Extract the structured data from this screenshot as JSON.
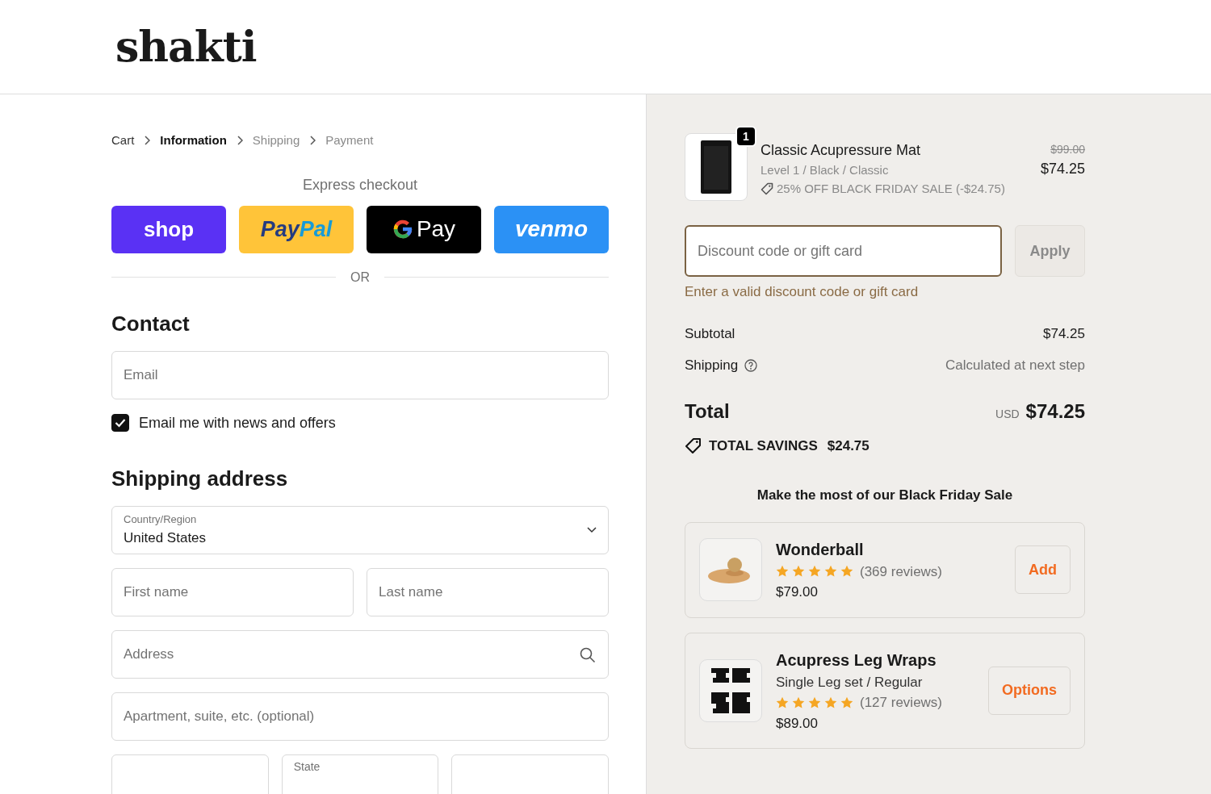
{
  "header": {
    "logo": "shakti"
  },
  "breadcrumb": [
    {
      "label": "Cart",
      "selected": false
    },
    {
      "label": "Information",
      "selected": true
    },
    {
      "label": "Shipping",
      "selected": false
    },
    {
      "label": "Payment",
      "selected": false
    }
  ],
  "express_checkout": {
    "title": "Express checkout",
    "wallets": [
      {
        "kind": "shop",
        "parts": [
          "shop"
        ]
      },
      {
        "kind": "paypal",
        "parts": [
          "Pay",
          "Pal"
        ]
      },
      {
        "kind": "gpay",
        "parts": [
          "Pay"
        ]
      },
      {
        "kind": "venmo",
        "parts": [
          "venmo"
        ]
      }
    ],
    "divider": "OR"
  },
  "contact": {
    "title": "Contact",
    "email": {
      "placeholder": "Email"
    },
    "newsletter": {
      "label": "Email me with news and offers",
      "checked": true
    }
  },
  "shipping_address": {
    "title": "Shipping address",
    "country": {
      "label": "Country/Region",
      "value": "United States"
    },
    "first_name": {
      "placeholder": "First name"
    },
    "last_name": {
      "placeholder": "Last name"
    },
    "address": {
      "placeholder": "Address"
    },
    "apartment": {
      "placeholder": "Apartment, suite, etc. (optional)"
    },
    "state": {
      "label": "State"
    }
  },
  "order": {
    "item": {
      "quantity": "1",
      "name": "Classic Acupressure Mat",
      "variant": "Level 1 / Black / Classic",
      "discount": "25% OFF BLACK FRIDAY SALE (-$24.75)",
      "original_price": "$99.00",
      "price": "$74.25"
    },
    "discount_field": {
      "placeholder": "Discount code or gift card",
      "button": "Apply",
      "error": "Enter a valid discount code or gift card"
    },
    "subtotal": {
      "label": "Subtotal",
      "value": "$74.25"
    },
    "shipping": {
      "label": "Shipping",
      "value": "Calculated at next step"
    },
    "total": {
      "label": "Total",
      "currency": "USD",
      "value": "$74.25"
    },
    "savings": {
      "label": "TOTAL SAVINGS",
      "value": "$24.75"
    },
    "upsell": {
      "title": "Make the most of our Black Friday Sale",
      "products": [
        {
          "kind": "ball",
          "name": "Wonderball",
          "stars": 5,
          "reviews": "(369 reviews)",
          "price": "$79.00",
          "button": "Add"
        },
        {
          "kind": "wraps",
          "name": "Acupress Leg Wraps",
          "variant": "Single Leg set / Regular",
          "stars": 5,
          "reviews": "(127 reviews)",
          "price": "$89.00",
          "button": "Options"
        }
      ]
    }
  }
}
